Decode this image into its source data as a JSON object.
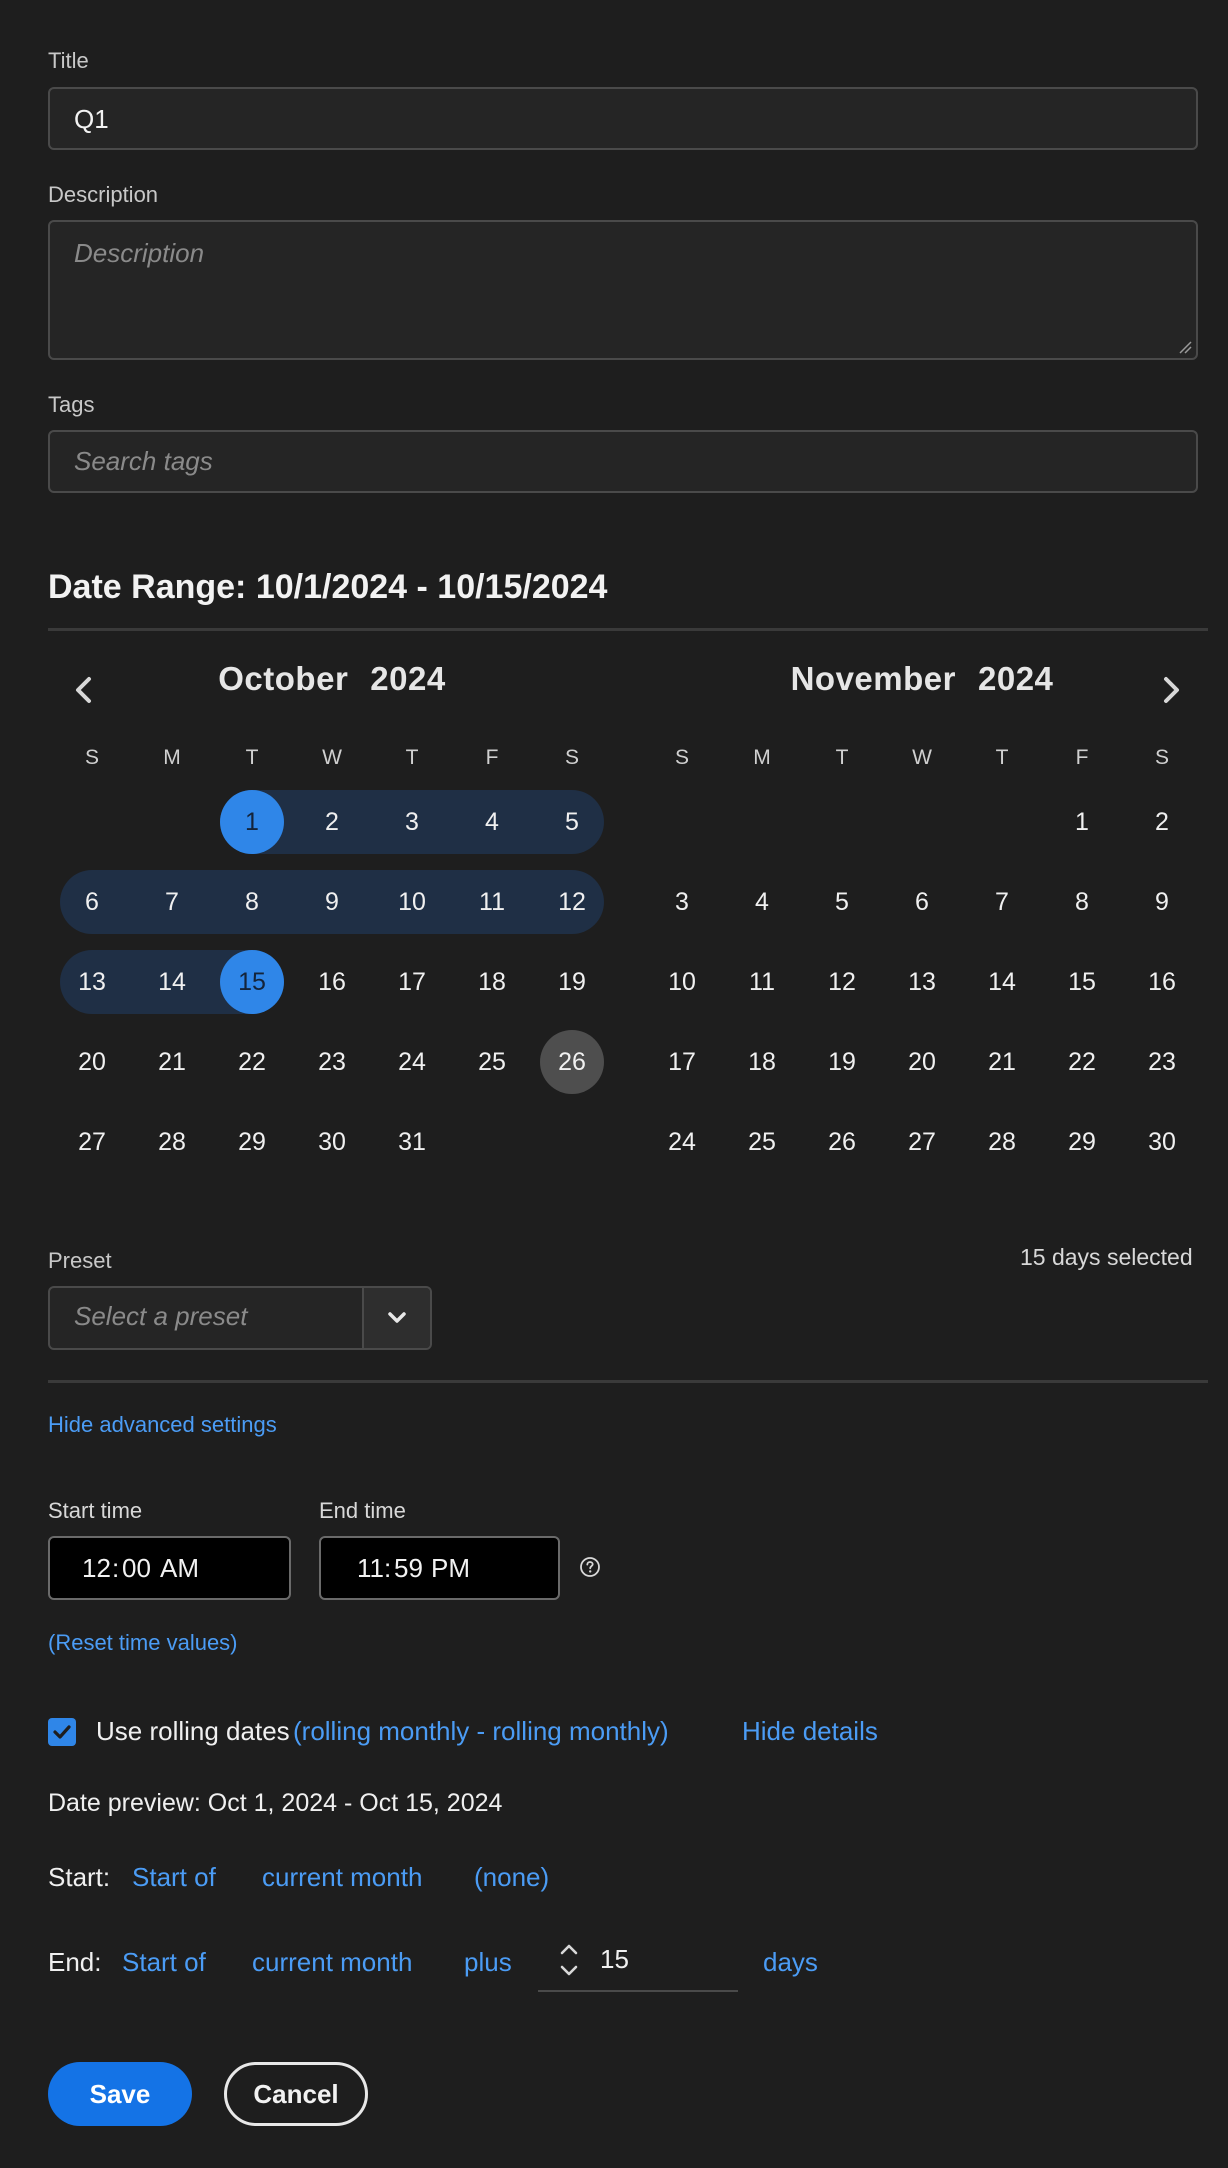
{
  "form": {
    "title_label": "Title",
    "title_value": "Q1",
    "description_label": "Description",
    "description_placeholder": "Description",
    "tags_label": "Tags",
    "tags_placeholder": "Search tags"
  },
  "date_range": {
    "heading": "Date Range: 10/1/2024 - 10/15/2024"
  },
  "calendar": {
    "weekdays": [
      "S",
      "M",
      "T",
      "W",
      "T",
      "F",
      "S"
    ],
    "left": {
      "month": "October",
      "year": "2024",
      "weeks": [
        [
          "",
          "",
          "1",
          "2",
          "3",
          "4",
          "5"
        ],
        [
          "6",
          "7",
          "8",
          "9",
          "10",
          "11",
          "12"
        ],
        [
          "13",
          "14",
          "15",
          "16",
          "17",
          "18",
          "19"
        ],
        [
          "20",
          "21",
          "22",
          "23",
          "24",
          "25",
          "26"
        ],
        [
          "27",
          "28",
          "29",
          "30",
          "31",
          "",
          ""
        ]
      ],
      "range_start": "1",
      "range_end": "15",
      "today": "26"
    },
    "right": {
      "month": "November",
      "year": "2024",
      "weeks": [
        [
          "",
          "",
          "",
          "",
          "",
          "1",
          "2"
        ],
        [
          "3",
          "4",
          "5",
          "6",
          "7",
          "8",
          "9"
        ],
        [
          "10",
          "11",
          "12",
          "13",
          "14",
          "15",
          "16"
        ],
        [
          "17",
          "18",
          "19",
          "20",
          "21",
          "22",
          "23"
        ],
        [
          "24",
          "25",
          "26",
          "27",
          "28",
          "29",
          "30"
        ]
      ]
    },
    "prev_icon": "chevron-left-icon",
    "next_icon": "chevron-right-icon"
  },
  "preset": {
    "label": "Preset",
    "placeholder": "Select a preset",
    "days_selected": "15 days selected"
  },
  "advanced": {
    "toggle_label": "Hide advanced settings",
    "start_time_label": "Start time",
    "start_time": {
      "hour": "12",
      "minute": "00",
      "period": "AM"
    },
    "end_time_label": "End time",
    "end_time": {
      "hour": "11",
      "minute": "59",
      "period": "PM"
    },
    "reset_label": "(Reset time values)",
    "rolling_checked": true,
    "rolling_label": "Use rolling dates",
    "rolling_detail": "(rolling monthly - rolling monthly)",
    "hide_details": "Hide details",
    "date_preview": "Date preview: Oct 1, 2024 - Oct 15, 2024",
    "start": {
      "label": "Start:",
      "anchor": "Start of",
      "period": "current month",
      "modifier": "(none)"
    },
    "end": {
      "label": "End:",
      "anchor": "Start of",
      "period": "current month",
      "modifier": "plus",
      "amount": "15",
      "unit": "days"
    }
  },
  "actions": {
    "save": "Save",
    "cancel": "Cancel"
  },
  "colors": {
    "accent": "#1473e6",
    "range_fill": "#1f2f45",
    "selected_day": "#2f86e8",
    "today_marker": "#4e4e4e",
    "link": "#4b9cf5"
  }
}
